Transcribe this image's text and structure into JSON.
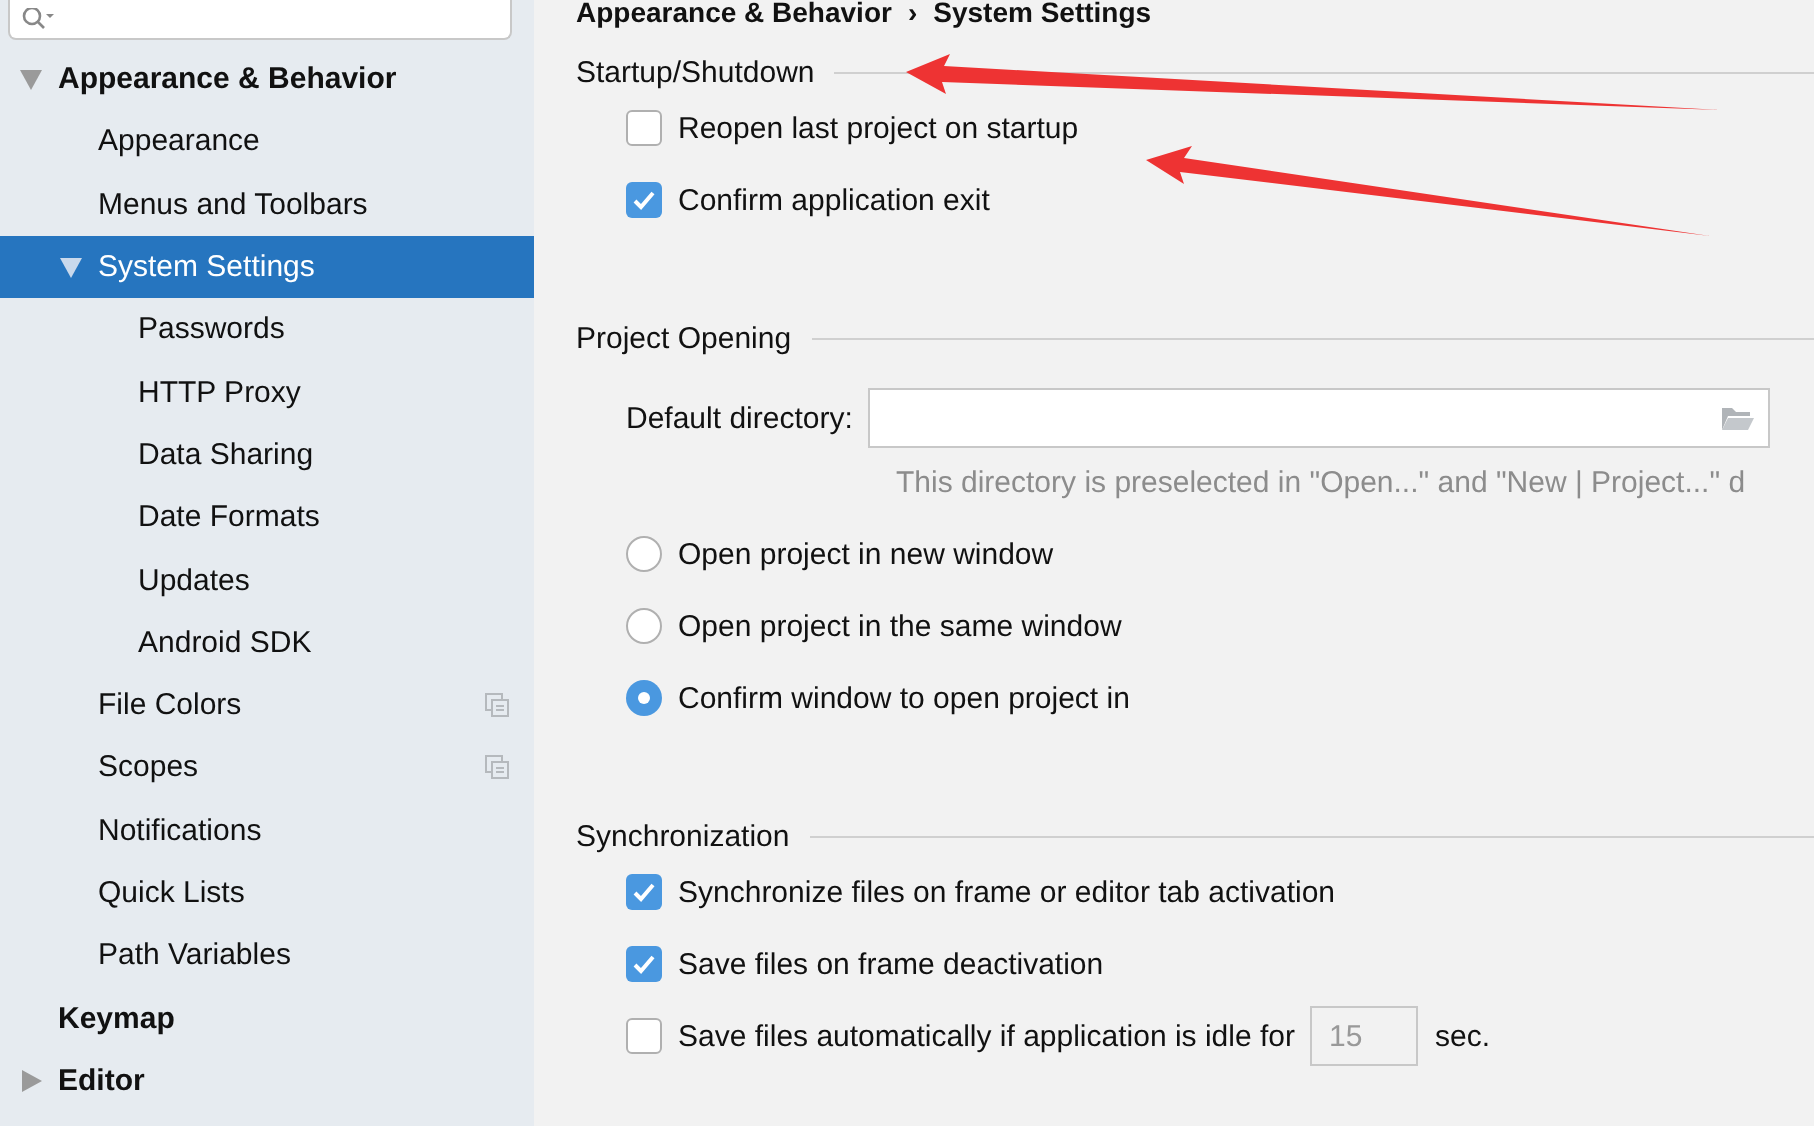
{
  "tree": [
    {
      "label": "Appearance & Behavior",
      "expanded": true,
      "selected": false,
      "project_icon": false,
      "children": [
        {
          "label": "Appearance",
          "selected": false,
          "project_icon": false
        },
        {
          "label": "Menus and Toolbars",
          "selected": false,
          "project_icon": false
        },
        {
          "label": "System Settings",
          "expanded": true,
          "selected": true,
          "project_icon": false,
          "children": [
            {
              "label": "Passwords",
              "selected": false,
              "project_icon": false
            },
            {
              "label": "HTTP Proxy",
              "selected": false,
              "project_icon": false
            },
            {
              "label": "Data Sharing",
              "selected": false,
              "project_icon": false
            },
            {
              "label": "Date Formats",
              "selected": false,
              "project_icon": false
            },
            {
              "label": "Updates",
              "selected": false,
              "project_icon": false
            },
            {
              "label": "Android SDK",
              "selected": false,
              "project_icon": false
            }
          ]
        },
        {
          "label": "File Colors",
          "selected": false,
          "project_icon": true
        },
        {
          "label": "Scopes",
          "selected": false,
          "project_icon": true
        },
        {
          "label": "Notifications",
          "selected": false,
          "project_icon": false
        },
        {
          "label": "Quick Lists",
          "selected": false,
          "project_icon": false
        },
        {
          "label": "Path Variables",
          "selected": false,
          "project_icon": false
        }
      ]
    },
    {
      "label": "Keymap",
      "selected": false,
      "project_icon": false
    },
    {
      "label": "Editor",
      "expanded": false,
      "selected": false,
      "project_icon": false
    }
  ],
  "breadcrumb": [
    "Appearance & Behavior",
    "›",
    "System Settings"
  ],
  "sections": [
    {
      "title": "Startup/Shutdown",
      "items": [
        {
          "kind": "checkbox",
          "label": "Reopen last project on startup",
          "checked": false
        },
        {
          "kind": "checkbox",
          "label": "Confirm application exit",
          "checked": true
        }
      ]
    },
    {
      "title": "Project Opening",
      "items": [
        {
          "kind": "path",
          "label": "Default directory:",
          "value": "",
          "hint": "This directory is preselected in \"Open...\" and \"New | Project...\" d"
        },
        {
          "kind": "radio",
          "label": "Open project in new window",
          "selected": false
        },
        {
          "kind": "radio",
          "label": "Open project in the same window",
          "selected": false
        },
        {
          "kind": "radio",
          "label": "Confirm window to open project in",
          "selected": true
        }
      ]
    },
    {
      "title": "Synchronization",
      "items": [
        {
          "kind": "checkbox",
          "label": "Synchronize files on frame or editor tab activation",
          "checked": true
        },
        {
          "kind": "checkbox",
          "label": "Save files on frame deactivation",
          "checked": true
        },
        {
          "kind": "checkbox",
          "label": "Save files automatically if application is idle for",
          "checked": false,
          "field": {
            "value": "15",
            "disabled": true
          },
          "suffix": "sec."
        }
      ]
    }
  ]
}
